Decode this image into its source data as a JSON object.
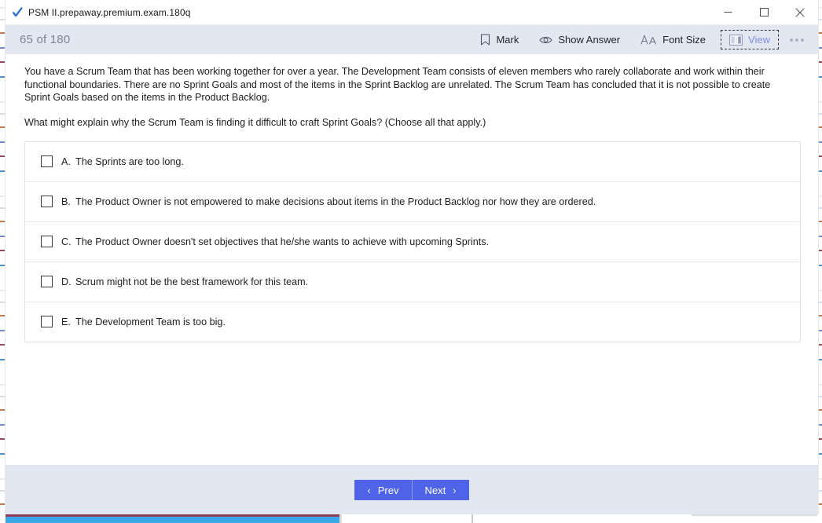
{
  "window": {
    "title": "PSM II.prepaway.premium.exam.180q",
    "app_icon": "checkmark-icon",
    "controls": {
      "minimize": "minimize-icon",
      "maximize": "maximize-icon",
      "close": "close-icon"
    }
  },
  "toolbar": {
    "counter": "65 of 180",
    "mark_label": "Mark",
    "show_answer_label": "Show Answer",
    "font_size_label": "Font Size",
    "view_label": "View",
    "more_label": ""
  },
  "question": {
    "stem": "You have a Scrum Team that has been working together for over a year. The Development Team consists of eleven members who rarely collaborate and work within their functional boundaries. There are no Sprint Goals and most of the items in the Sprint Backlog are unrelated. The Scrum Team has concluded that it is not possible to create Sprint Goals based on the items in the Product Backlog.",
    "prompt": "What might explain why the Scrum Team is finding it difficult to craft Sprint Goals? (Choose all that apply.)",
    "options": [
      {
        "letter": "A.",
        "text": "The Sprints are too long.",
        "checked": false
      },
      {
        "letter": "B.",
        "text": "The Product Owner is not empowered to make decisions about items in the Product Backlog nor how they are ordered.",
        "checked": false
      },
      {
        "letter": "C.",
        "text": "The Product Owner doesn't set objectives that he/she wants to achieve with upcoming Sprints.",
        "checked": false
      },
      {
        "letter": "D.",
        "text": "Scrum might not be the best framework for this team.",
        "checked": false
      },
      {
        "letter": "E.",
        "text": "The Development Team is too big.",
        "checked": false
      }
    ]
  },
  "footer": {
    "prev_label": "Prev",
    "next_label": "Next",
    "prev_chevron": "‹",
    "next_chevron": "›"
  },
  "colors": {
    "toolbar_bg": "#e3e7f1",
    "accent_button": "#4f63e8",
    "counter_text": "#7a8397",
    "view_text": "#7a8fe0"
  }
}
